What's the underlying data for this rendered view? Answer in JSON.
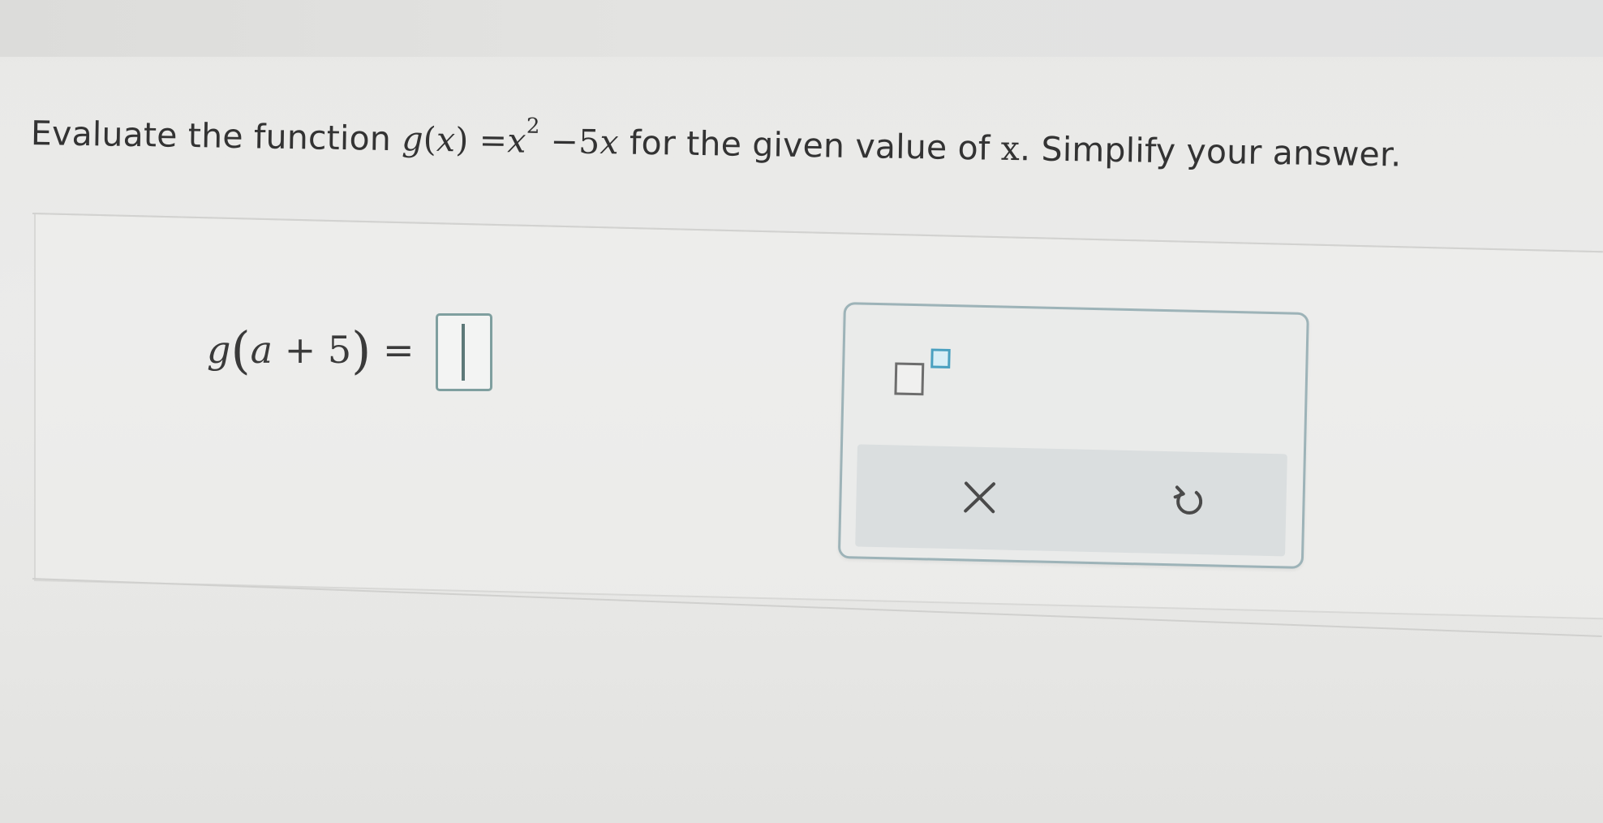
{
  "question": {
    "intro": "Evaluate the function",
    "func_name": "g",
    "arg_open": "(",
    "arg": "x",
    "arg_close": ")",
    "equals": "=",
    "term1_base": "x",
    "term1_exp": "2",
    "minus": "−",
    "term2_coef": "5",
    "term2_var": "x",
    "mid": "for the given value of",
    "var": "x",
    "outro": ". Simplify your answer."
  },
  "equation": {
    "func_name": "g",
    "open": "(",
    "input_var": "a",
    "plus": "+",
    "input_const": "5",
    "close": ")",
    "equals": "="
  },
  "answer": {
    "value": ""
  },
  "keypad": {
    "exponent_icon": "exponent-template-icon",
    "clear_icon": "close-icon",
    "clear_symbol": "✕",
    "undo_icon": "undo-icon"
  },
  "colors": {
    "accent": "#4aa0c0",
    "keypad_border": "#9db3b8",
    "answer_border": "#7f9f9f",
    "action_bar": "#dadedf"
  }
}
